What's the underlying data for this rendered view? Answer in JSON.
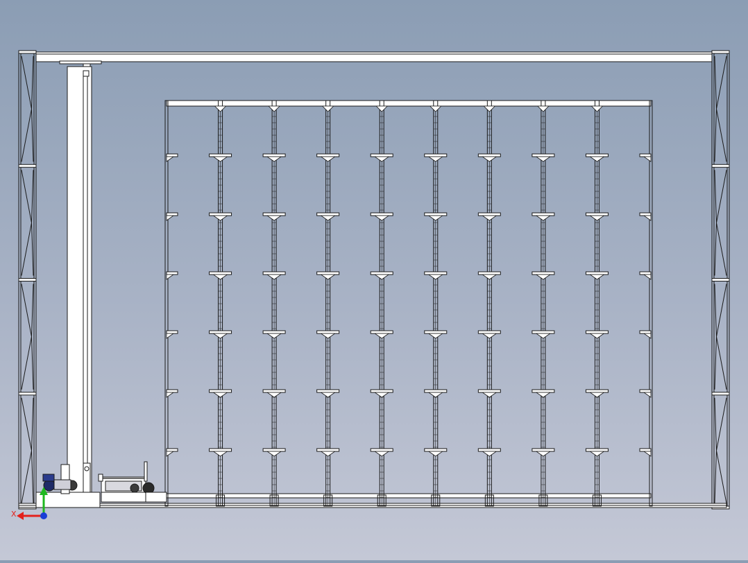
{
  "colors": {
    "background_top": "#8b9db4",
    "background_bottom": "#c4c8d6",
    "line": "#1a1a1a",
    "fill": "#ffffff",
    "axis_x": "#e3211c",
    "axis_y": "#1fb81f",
    "axis_origin": "#1a3fd6"
  },
  "axis_triad": {
    "x_label": "X"
  },
  "model": {
    "rack": {
      "bays": 9,
      "levels": 6
    },
    "end_frames": {
      "panels": 4
    }
  }
}
